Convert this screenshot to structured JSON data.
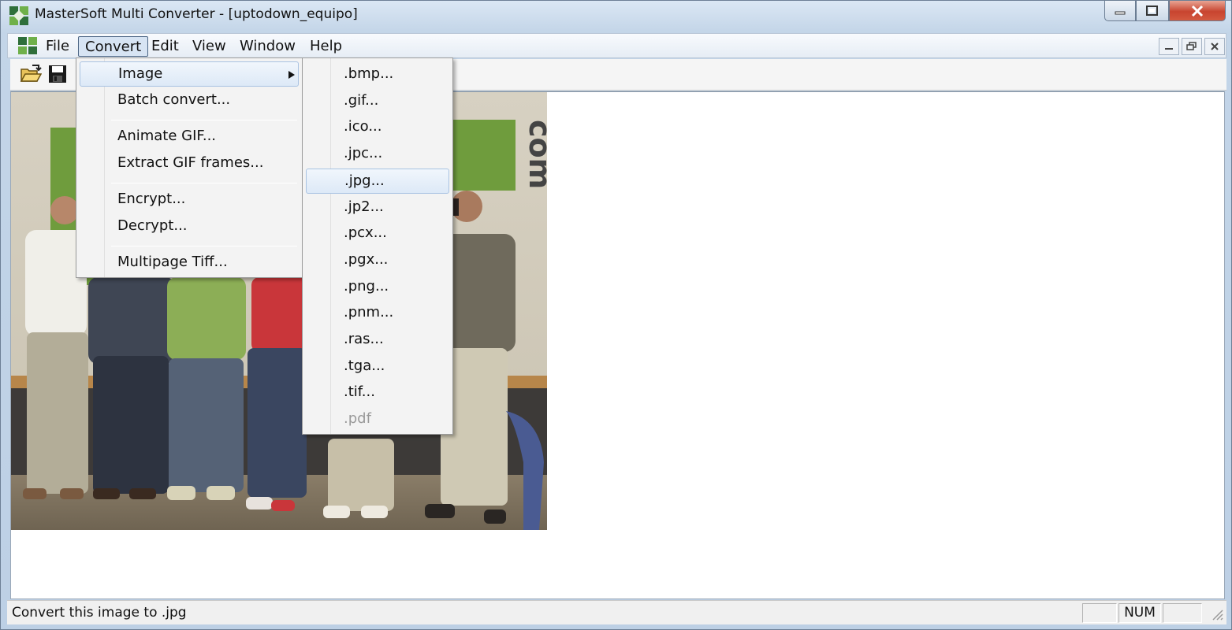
{
  "window": {
    "title": "MasterSoft Multi Converter - [uptodown_equipo]"
  },
  "menubar": {
    "items": [
      "File",
      "Convert",
      "Edit",
      "View",
      "Window",
      "Help"
    ]
  },
  "convert_menu": {
    "items": [
      "Image",
      "Batch convert...",
      "Animate GIF...",
      "Extract GIF frames...",
      "Encrypt...",
      "Decrypt...",
      "Multipage Tiff..."
    ]
  },
  "image_submenu": {
    "items": [
      ".bmp...",
      ".gif...",
      ".ico...",
      ".jpc...",
      ".jpg...",
      ".jp2...",
      ".pcx...",
      ".pgx...",
      ".png...",
      ".pnm...",
      ".ras...",
      ".tga...",
      ".tif...",
      ".pdf"
    ],
    "highlighted": ".jpg...",
    "disabled": ".pdf"
  },
  "photo": {
    "sign_text": "com"
  },
  "statusbar": {
    "message": "Convert this image to .jpg",
    "num": "NUM"
  },
  "colors": {
    "accent": "#d7e4f3",
    "close": "#c8442f"
  },
  "icons": [
    "app-icon",
    "open-folder-icon",
    "save-disk-icon",
    "submenu-arrow-icon",
    "minimize-icon",
    "maximize-icon",
    "close-icon"
  ]
}
